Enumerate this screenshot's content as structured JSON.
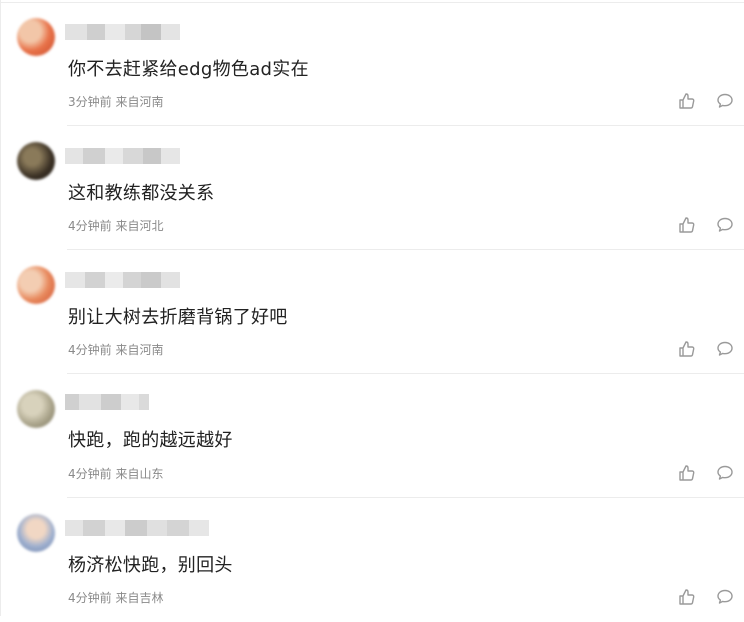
{
  "comments": [
    {
      "text": "你不去赶紧给edg物色ad实在",
      "time": "3分钟前",
      "location": "来自河南"
    },
    {
      "text": "这和教练都没关系",
      "time": "4分钟前",
      "location": "来自河北"
    },
    {
      "text": "别让大树去折磨背锅了好吧",
      "time": "4分钟前",
      "location": "来自河南"
    },
    {
      "text": "快跑，跑的越远越好",
      "time": "4分钟前",
      "location": "来自山东"
    },
    {
      "text": "杨济松快跑，别回头",
      "time": "4分钟前",
      "location": "来自吉林"
    }
  ],
  "icons": {
    "like": "thumbs-up-icon",
    "reply": "comment-bubble-icon"
  },
  "colors": {
    "text": "#222222",
    "meta": "#8a8a8a",
    "icon": "#9a9a9a",
    "divider": "#ececec"
  }
}
